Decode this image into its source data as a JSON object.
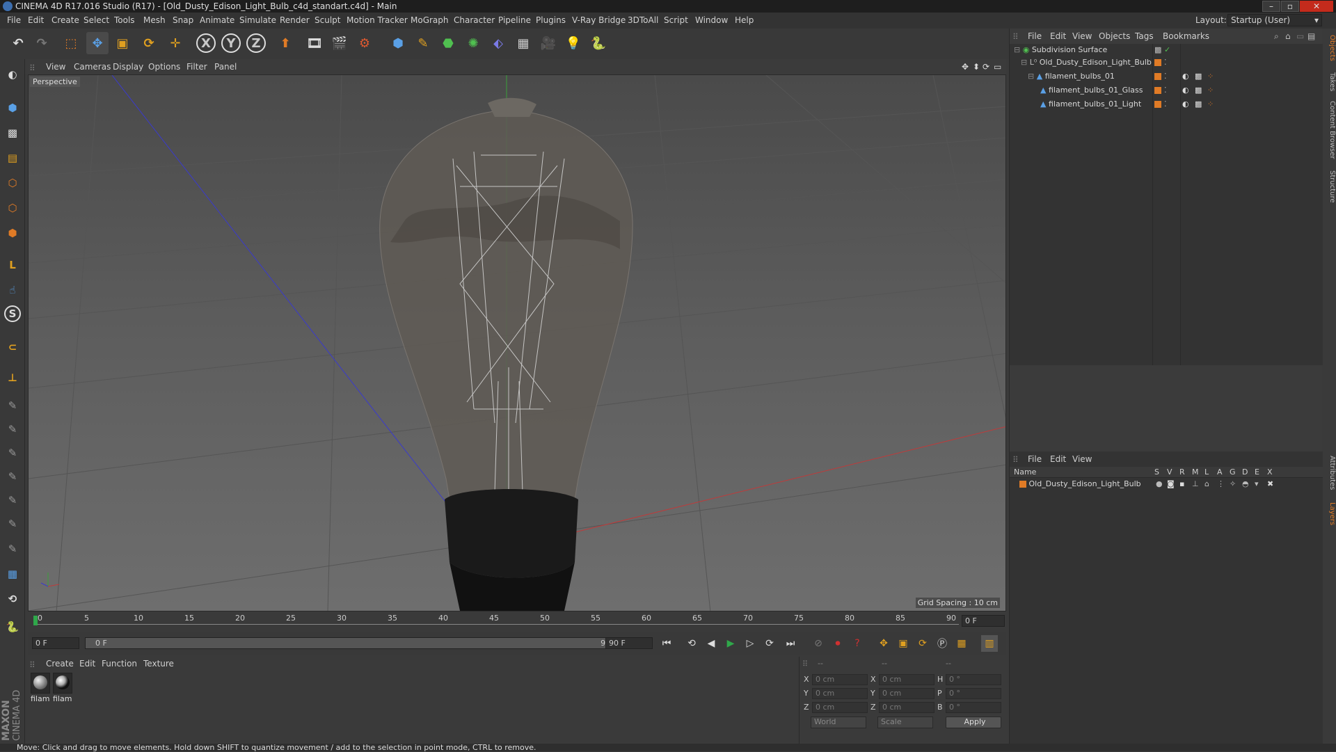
{
  "window": {
    "title": "CINEMA 4D R17.016 Studio (R17) - [Old_Dusty_Edison_Light_Bulb_c4d_standart.c4d] - Main",
    "layout_label": "Layout:",
    "layout_value": "Startup (User)"
  },
  "menubar": [
    "File",
    "Edit",
    "Create",
    "Select",
    "Tools",
    "Mesh",
    "Snap",
    "Animate",
    "Simulate",
    "Render",
    "Sculpt",
    "Motion Tracker",
    "MoGraph",
    "Character",
    "Pipeline",
    "Plugins",
    "V-Ray Bridge",
    "3DToAll",
    "Script",
    "Window",
    "Help"
  ],
  "toolbar": {
    "axis_x": "X",
    "axis_y": "Y",
    "axis_z": "Z"
  },
  "viewport": {
    "menu": [
      "View",
      "Cameras",
      "Display",
      "Options",
      "Filter",
      "Panel"
    ],
    "label": "Perspective",
    "grid_spacing": "Grid Spacing : 10 cm"
  },
  "timeline": {
    "ticks": [
      "0",
      "5",
      "10",
      "15",
      "20",
      "25",
      "30",
      "35",
      "40",
      "45",
      "50",
      "55",
      "60",
      "65",
      "70",
      "75",
      "80",
      "85",
      "90"
    ],
    "current_frame_right": "0 F",
    "start_field": "0 F",
    "range_start": "0 F",
    "range_end": "90 F",
    "end_field": "90 F"
  },
  "materials": {
    "menu": [
      "Create",
      "Edit",
      "Function",
      "Texture"
    ],
    "items": [
      "filam",
      "filam"
    ]
  },
  "coordinates": {
    "header": [
      "--",
      "--",
      "--"
    ],
    "rows": [
      {
        "a": "X",
        "av": "0 cm",
        "b": "X",
        "bv": "0 cm",
        "c": "H",
        "cv": "0 °"
      },
      {
        "a": "Y",
        "av": "0 cm",
        "b": "Y",
        "bv": "0 cm",
        "c": "P",
        "cv": "0 °"
      },
      {
        "a": "Z",
        "av": "0 cm",
        "b": "Z",
        "bv": "0 cm",
        "c": "B",
        "cv": "0 °"
      }
    ],
    "world": "World",
    "scale": "Scale",
    "apply": "Apply"
  },
  "objects_panel": {
    "menu": [
      "File",
      "Edit",
      "View",
      "Objects",
      "Tags",
      "Bookmarks"
    ],
    "items": [
      "Subdivision Surface",
      "Old_Dusty_Edison_Light_Bulb",
      "filament_bulbs_01",
      "filament_bulbs_01_Glass",
      "filament_bulbs_01_Light"
    ]
  },
  "layers_panel": {
    "menu": [
      "File",
      "Edit",
      "View"
    ],
    "name_header": "Name",
    "columns": [
      "S",
      "V",
      "R",
      "M",
      "L",
      "A",
      "G",
      "D",
      "E",
      "X"
    ],
    "rows": [
      "Old_Dusty_Edison_Light_Bulb"
    ]
  },
  "side_tabs": [
    "Objects",
    "Takes",
    "Content Browser",
    "Structure",
    "Attributes",
    "Layers"
  ],
  "brand": [
    "MAXON",
    "CINEMA 4D"
  ],
  "status": "Move: Click and drag to move elements. Hold down SHIFT to quantize movement / add to the selection in point mode, CTRL to remove.",
  "colors": {
    "accent": "#e07b26",
    "bg": "#3a3a3a",
    "grid_x": "#c03a3a",
    "grid_z": "#3a3acc",
    "grid_y": "#3aa03a"
  }
}
